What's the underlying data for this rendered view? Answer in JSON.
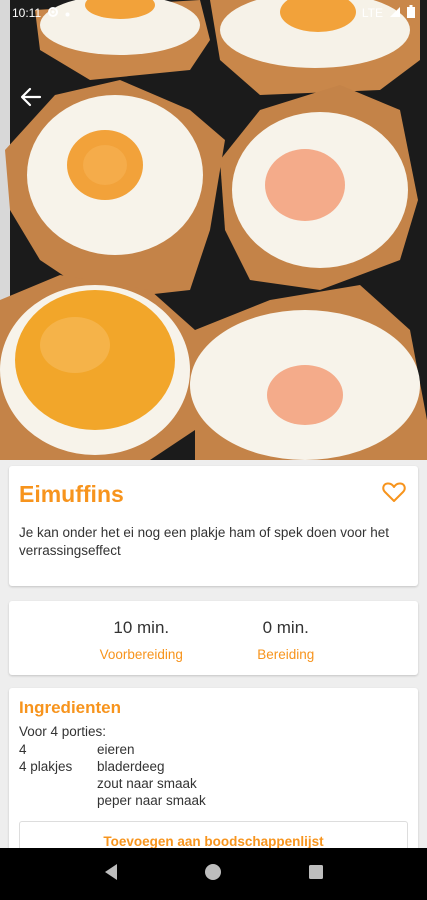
{
  "status_bar": {
    "time": "10:11",
    "network": "LTE",
    "icons": [
      "settings-icon",
      "dot-icon",
      "signal-icon",
      "battery-icon"
    ]
  },
  "hero": {
    "image": "egg-muffins-photo",
    "back_icon": "arrow-left-icon"
  },
  "recipe": {
    "title": "Eimuffins",
    "description": "Je kan onder het ei nog een plakje ham of spek doen voor het verrassingseffect",
    "favorite_icon": "heart-outline-icon"
  },
  "times": [
    {
      "value": "10 min.",
      "label": "Voorbereiding"
    },
    {
      "value": "0 min.",
      "label": "Bereiding"
    }
  ],
  "ingredients": {
    "title": "Ingredienten",
    "portions": "Voor 4 porties:",
    "items": [
      {
        "qty": "4",
        "name": "eieren"
      },
      {
        "qty": "4 plakjes",
        "name": "bladerdeeg"
      },
      {
        "qty": "",
        "name": "zout naar smaak"
      },
      {
        "qty": "",
        "name": "peper naar smaak"
      }
    ],
    "add_to_list_label": "Toevoegen aan boodschappenlijst"
  },
  "nav": {
    "icons": [
      "back-triangle-icon",
      "home-circle-icon",
      "recents-square-icon"
    ]
  },
  "colors": {
    "accent": "#f7941d",
    "nav_bg": "#000000"
  }
}
